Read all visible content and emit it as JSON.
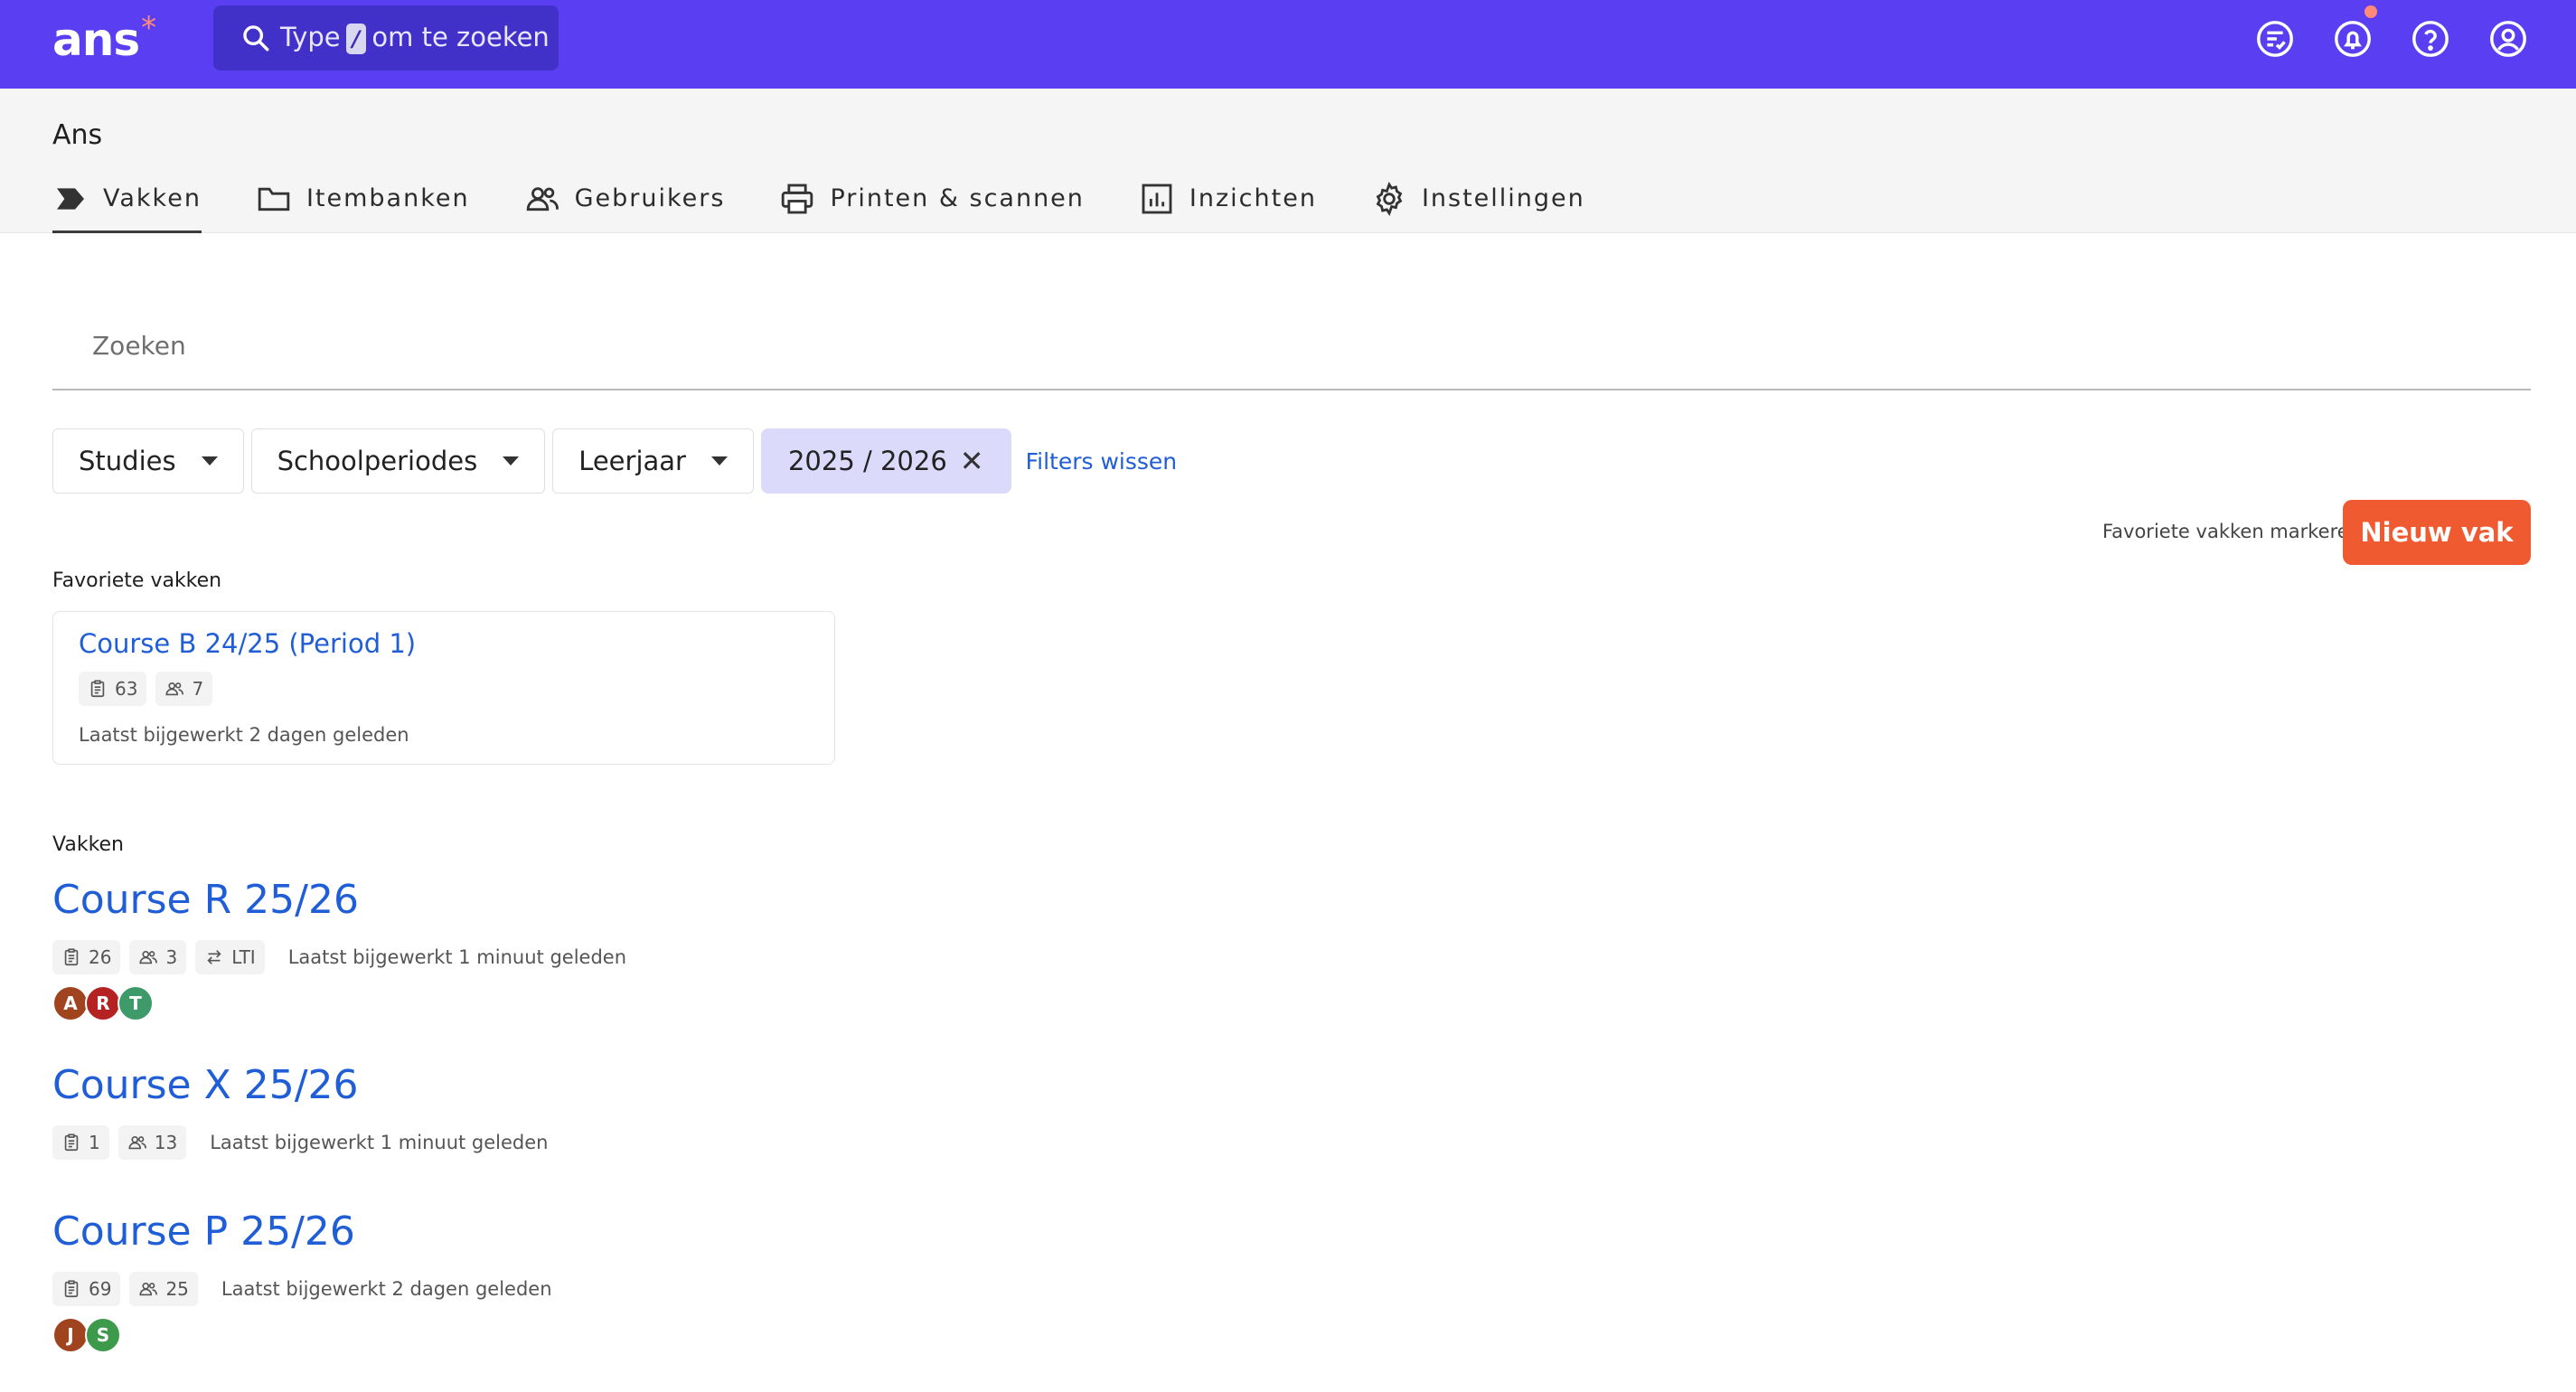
{
  "topbar": {
    "logo": "ans",
    "logo_mark": "*",
    "search_prefix": "Type",
    "search_key": "/",
    "search_suffix": "om te zoeken",
    "icons": [
      "tasks-icon",
      "notifications-icon",
      "help-icon",
      "account-icon"
    ],
    "colors": {
      "bar": "#5a3ff2",
      "search": "#4231c9",
      "notification_dot": "#ff8a7a"
    }
  },
  "subheader": {
    "title": "Ans",
    "tabs": [
      {
        "label": "Vakken",
        "icon": "course-chevron-icon",
        "active": true
      },
      {
        "label": "Itembanken",
        "icon": "folder-icon"
      },
      {
        "label": "Gebruikers",
        "icon": "users-icon"
      },
      {
        "label": "Printen & scannen",
        "icon": "printer-icon"
      },
      {
        "label": "Inzichten",
        "icon": "chart-icon"
      },
      {
        "label": "Instellingen",
        "icon": "gear-icon"
      }
    ]
  },
  "search": {
    "placeholder": "Zoeken"
  },
  "filters": {
    "studies": "Studies",
    "periods": "Schoolperiodes",
    "year_level": "Leerjaar",
    "active_chip": "2025 / 2026",
    "clear": "Filters wissen"
  },
  "actions": {
    "mark_favorites": "Favoriete vakken markeren",
    "new_course": "Nieuw vak",
    "accent": "#f05a30"
  },
  "favorites": {
    "label": "Favoriete vakken",
    "cards": [
      {
        "title": "Course B 24/25 (Period 1)",
        "items": "63",
        "users": "7",
        "updated": "Laatst bijgewerkt 2 dagen geleden"
      }
    ]
  },
  "courses": {
    "label": "Vakken",
    "list": [
      {
        "title": "Course R 25/26",
        "items": "26",
        "users": "3",
        "lti": "LTI",
        "updated": "Laatst bijgewerkt 1 minuut geleden",
        "avatars": [
          {
            "letter": "A",
            "color": "#a0431f"
          },
          {
            "letter": "R",
            "color": "#b42222"
          },
          {
            "letter": "T",
            "color": "#3f9a6a"
          }
        ]
      },
      {
        "title": "Course X 25/26",
        "items": "1",
        "users": "13",
        "updated": "Laatst bijgewerkt 1 minuut geleden",
        "avatars": []
      },
      {
        "title": "Course P 25/26",
        "items": "69",
        "users": "25",
        "updated": "Laatst bijgewerkt 2 dagen geleden",
        "avatars": [
          {
            "letter": "J",
            "color": "#a0431f"
          },
          {
            "letter": "S",
            "color": "#3c9a4a"
          }
        ]
      }
    ]
  }
}
